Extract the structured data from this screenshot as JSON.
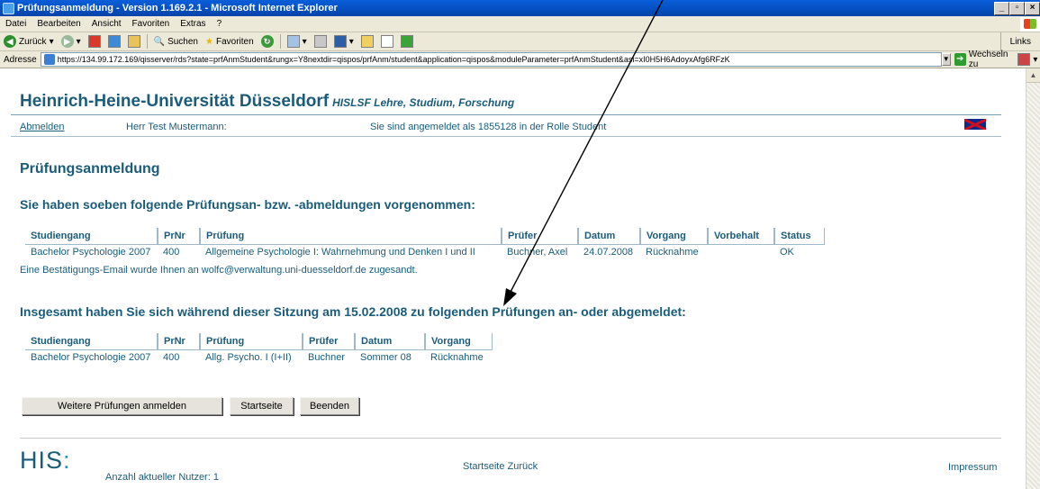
{
  "browser": {
    "title": "Prüfungsanmeldung - Version 1.169.2.1 - Microsoft Internet Explorer",
    "menu": [
      "Datei",
      "Bearbeiten",
      "Ansicht",
      "Favoriten",
      "Extras",
      "?"
    ],
    "toolbar": {
      "back": "Zurück",
      "search": "Suchen",
      "favorites": "Favoriten",
      "links": "Links"
    },
    "address": {
      "label": "Adresse",
      "url": "https://134.99.172.169/qisserver/rds?state=prfAnmStudent&rungx=Y8nextdir=qispos/prfAnm/student&application=qispos&moduleParameter=prfAnmStudent&asi=xI0H5H6AdoyxAfg6RFzK",
      "go": "Wechseln zu"
    }
  },
  "header": {
    "university": "Heinrich-Heine-Universität Düsseldorf",
    "subtitle": "HISLSF Lehre, Studium, Forschung",
    "logout": "Abmelden",
    "user": "Herr Test Mustermann:",
    "login_info": "Sie sind angemeldet als 1855128 in der Rolle Student"
  },
  "page": {
    "title": "Prüfungsanmeldung",
    "section1": "Sie haben soeben folgende Prüfungsan- bzw. -abmeldungen vorgenommen:",
    "section2": "Insgesamt haben Sie sich während dieser Sitzung am 15.02.2008 zu folgenden Prüfungen an- oder abgemeldet:",
    "email_note": "Eine Bestätigungs-Email wurde Ihnen an wolfc@verwaltung.uni-duesseldorf.de zugesandt."
  },
  "table1": {
    "headers": [
      "Studiengang",
      "PrNr",
      "Prüfung",
      "Prüfer",
      "Datum",
      "Vorgang",
      "Vorbehalt",
      "Status"
    ],
    "rows": [
      [
        "Bachelor Psychologie 2007",
        "400",
        "Allgemeine Psychologie I: Wahrnehmung und Denken I und II",
        "Buchner, Axel",
        "24.07.2008",
        "Rücknahme",
        "",
        "OK"
      ]
    ]
  },
  "table2": {
    "headers": [
      "Studiengang",
      "PrNr",
      "Prüfung",
      "Prüfer",
      "Datum",
      "Vorgang"
    ],
    "rows": [
      [
        "Bachelor Psychologie 2007",
        "400",
        "Allg. Psycho. I (I+II)",
        "Buchner",
        "Sommer 08",
        "Rücknahme"
      ]
    ]
  },
  "buttons": {
    "more": "Weitere Prüfungen anmelden",
    "home": "Startseite",
    "end": "Beenden"
  },
  "footer": {
    "logo": "HIS",
    "users": "Anzahl aktueller Nutzer: 1",
    "home_link": "Startseite",
    "back_link": "Zurück",
    "impressum": "Impressum"
  },
  "colors": {
    "primary": "#1a5c7a",
    "titlebar": "#0551c4",
    "chrome": "#ece9d8"
  }
}
